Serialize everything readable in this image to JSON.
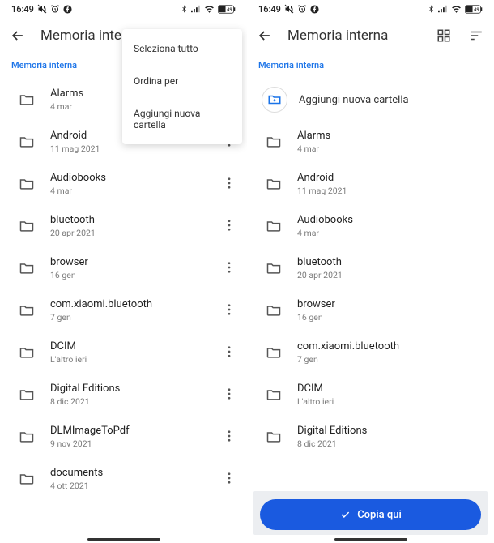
{
  "status": {
    "time": "16:49"
  },
  "left": {
    "title": "Memoria interna",
    "breadcrumb": "Memoria interna",
    "menu": {
      "item1": "Seleziona tutto",
      "item2": "Ordina per",
      "item3": "Aggiungi nuova cartella"
    },
    "items": [
      {
        "name": "Alarms",
        "sub": "4 mar"
      },
      {
        "name": "Android",
        "sub": "11 mag 2021"
      },
      {
        "name": "Audiobooks",
        "sub": "4 mar"
      },
      {
        "name": "bluetooth",
        "sub": "20 apr 2021"
      },
      {
        "name": "browser",
        "sub": "16 gen"
      },
      {
        "name": "com.xiaomi.bluetooth",
        "sub": "7 gen"
      },
      {
        "name": "DCIM",
        "sub": "L'altro ieri"
      },
      {
        "name": "Digital Editions",
        "sub": "8 dic 2021"
      },
      {
        "name": "DLMImageToPdf",
        "sub": "9 nov 2021"
      },
      {
        "name": "documents",
        "sub": "4 ott 2021"
      }
    ]
  },
  "right": {
    "title": "Memoria interna",
    "breadcrumb": "Memoria interna",
    "newFolder": "Aggiungi nuova cartella",
    "copyLabel": "Copia qui",
    "items": [
      {
        "name": "Alarms",
        "sub": "4 mar"
      },
      {
        "name": "Android",
        "sub": "11 mag 2021"
      },
      {
        "name": "Audiobooks",
        "sub": "4 mar"
      },
      {
        "name": "bluetooth",
        "sub": "20 apr 2021"
      },
      {
        "name": "browser",
        "sub": "16 gen"
      },
      {
        "name": "com.xiaomi.bluetooth",
        "sub": "7 gen"
      },
      {
        "name": "DCIM",
        "sub": "L'altro ieri"
      },
      {
        "name": "Digital Editions",
        "sub": "8 dic 2021"
      }
    ]
  }
}
